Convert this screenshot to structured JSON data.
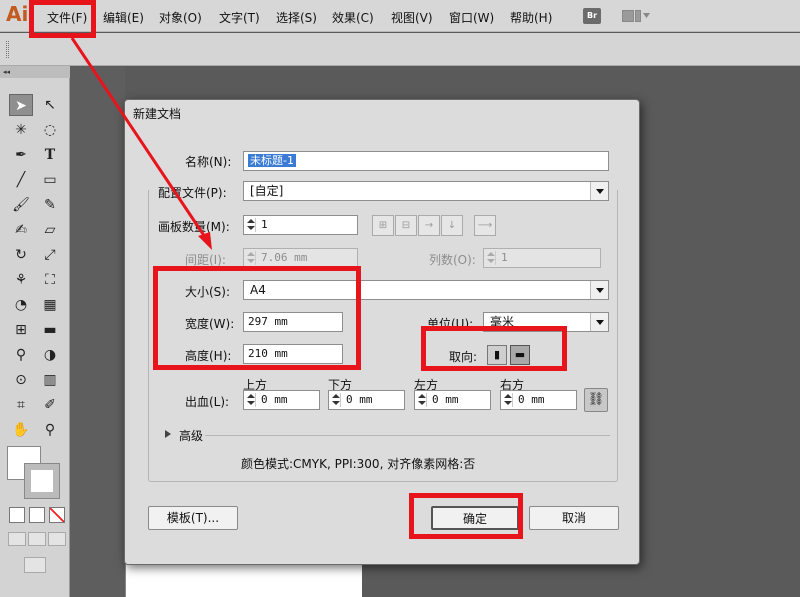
{
  "app": {
    "logo": "Ai"
  },
  "menubar": {
    "items": [
      "文件(F)",
      "编辑(E)",
      "对象(O)",
      "文字(T)",
      "选择(S)",
      "效果(C)",
      "视图(V)",
      "窗口(W)",
      "帮助(H)"
    ],
    "bridge_label": "Br"
  },
  "dialog": {
    "title": "新建文档",
    "name_label": "名称(N):",
    "name_value": "未标题-1",
    "profile_label": "配置文件(P):",
    "profile_value": "[自定]",
    "artboards_label": "画板数量(M):",
    "artboards_value": "1",
    "spacing_label": "间距(I):",
    "spacing_value": "7.06 mm",
    "columns_label": "列数(O):",
    "columns_value": "1",
    "size_label": "大小(S):",
    "size_value": "A4",
    "width_label": "宽度(W):",
    "width_value": "297 mm",
    "height_label": "高度(H):",
    "height_value": "210 mm",
    "units_label": "单位(U):",
    "units_value": "毫米",
    "orientation_label": "取向:",
    "bleed_label": "出血(L):",
    "bleed_top_label": "上方",
    "bleed_bottom_label": "下方",
    "bleed_left_label": "左方",
    "bleed_right_label": "右方",
    "bleed_top_value": "0 mm",
    "bleed_bottom_value": "0 mm",
    "bleed_left_value": "0 mm",
    "bleed_right_value": "0 mm",
    "advanced_label": "高级",
    "info_text": "颜色模式:CMYK, PPI:300, 对齐像素网格:否",
    "template_button": "模板(T)...",
    "ok_button": "确定",
    "cancel_button": "取消"
  },
  "colors": {
    "annotation_red": "#e8141c",
    "selection_blue": "#3a7bd5",
    "logo_orange": "#c35a20"
  }
}
